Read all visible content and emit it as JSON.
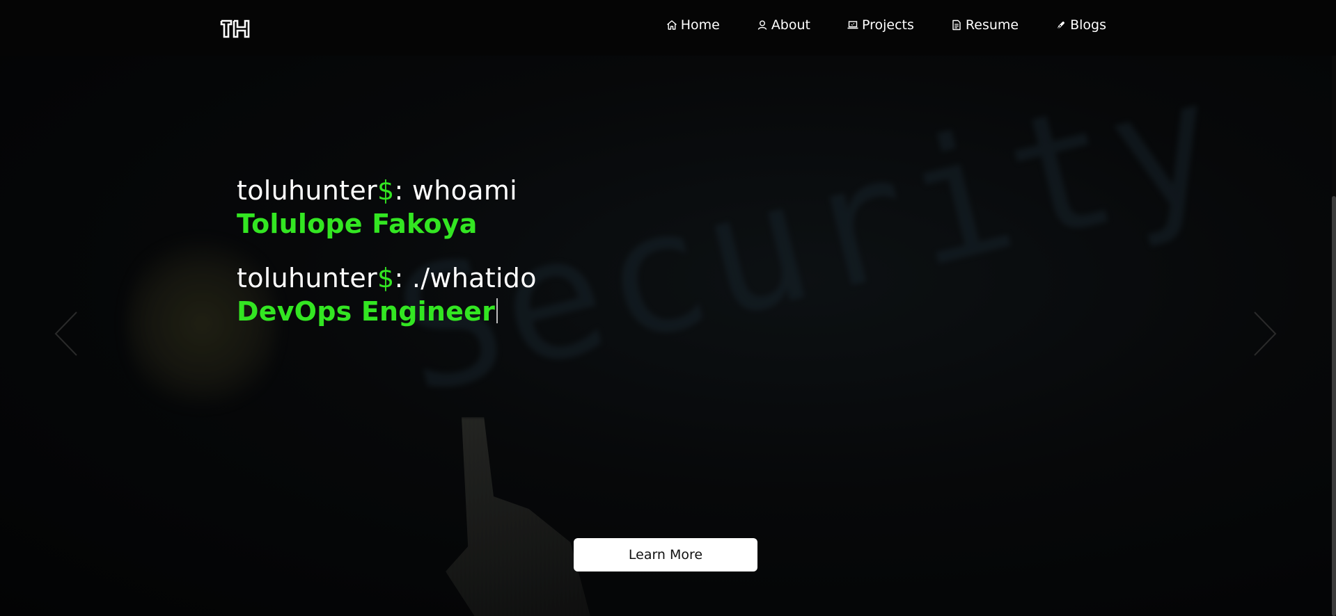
{
  "navbar": {
    "logo_text": "TH",
    "items": [
      {
        "label": "Home",
        "icon": "home-icon"
      },
      {
        "label": "About",
        "icon": "user-icon"
      },
      {
        "label": "Projects",
        "icon": "laptop-icon"
      },
      {
        "label": "Resume",
        "icon": "document-icon"
      },
      {
        "label": "Blogs",
        "icon": "pen-icon"
      }
    ]
  },
  "hero": {
    "background_word": "Security",
    "lines": [
      {
        "user": "toluhunter",
        "symbol": "$",
        "command": ": whoami",
        "output": "Tolulope Fakoya"
      },
      {
        "user": "toluhunter",
        "symbol": "$",
        "command": ": ./whatido",
        "output": "DevOps Engineer"
      }
    ],
    "button_label": "Learn More"
  },
  "colors": {
    "accent": "#33e622",
    "navbar_bg": "#050505",
    "button_bg": "#ffffff"
  }
}
